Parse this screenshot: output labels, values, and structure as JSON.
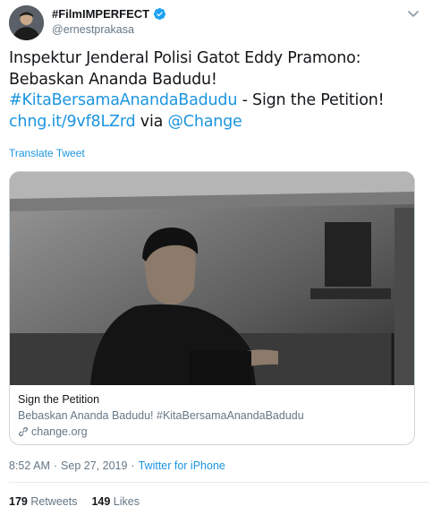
{
  "user": {
    "display_name": "#FilmIMPERFECT",
    "handle": "@ernestprakasa"
  },
  "tweet": {
    "line1": "Inspektur Jenderal Polisi Gatot Eddy Pramono:",
    "line2": "Bebaskan Ananda Badudu!",
    "hashtag": "#KitaBersamaAnandaBadudu",
    "line3_rest": " - Sign the Petition!",
    "short_link": "chng.it/9vf8LZrd",
    "via_text": " via ",
    "mention": "@Change"
  },
  "translate_label": "Translate Tweet",
  "card": {
    "title": "Sign the Petition",
    "description": "Bebaskan Ananda Badudu! #KitaBersamaAnandaBadudu",
    "domain": "change.org"
  },
  "meta": {
    "time": "8:52 AM",
    "separator1": "·",
    "date": "Sep 27, 2019",
    "separator2": "·",
    "source": "Twitter for iPhone"
  },
  "stats": {
    "retweets_count": "179",
    "retweets_label": "Retweets",
    "likes_count": "149",
    "likes_label": "Likes"
  },
  "colors": {
    "link": "#1b95e0",
    "verified": "#1da1f2",
    "secondary_text": "#657786"
  },
  "icons": [
    "verified-badge-icon",
    "chevron-down-icon",
    "link-icon"
  ]
}
